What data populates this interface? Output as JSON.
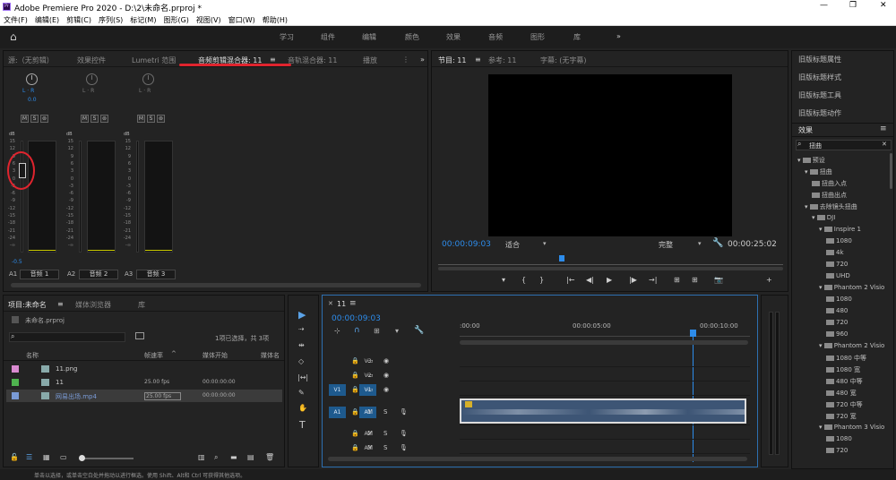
{
  "window": {
    "title": "Adobe Premiere Pro 2020 - D:\\2\\未命名.prproj *"
  },
  "menu": [
    "文件(F)",
    "编辑(E)",
    "剪辑(C)",
    "序列(S)",
    "标记(M)",
    "图形(G)",
    "视图(V)",
    "窗口(W)",
    "帮助(H)"
  ],
  "workspaces": [
    "学习",
    "组件",
    "编辑",
    "颜色",
    "效果",
    "音频",
    "图形",
    "库"
  ],
  "source_panel": {
    "tabs": [
      "源:（无剪辑）",
      "效果控件",
      "Lumetri 范围",
      "音频剪辑混合器: 11",
      "音轨混合器: 11",
      "播放"
    ],
    "channels": [
      {
        "lr": "L  ·  R",
        "val": "0.0",
        "name": "音频 1",
        "code": "A1"
      },
      {
        "lr": "L  ·  R",
        "val": "",
        "name": "音频 2",
        "code": "A2"
      },
      {
        "lr": "L  ·  R",
        "val": "",
        "name": "音频 3",
        "code": "A3"
      }
    ],
    "msb": [
      "M",
      "S",
      "⊚"
    ],
    "db_label": "dB",
    "scale": [
      "15",
      "12",
      "9",
      "6",
      "3",
      "0",
      "-3",
      "-6",
      "-9",
      "-12",
      "-15",
      "-18",
      "-21",
      "-24",
      "-∞"
    ],
    "fader_value": "-0.5"
  },
  "program": {
    "tabs": [
      "节目: 11",
      "参考: 11",
      "字幕: (无字幕)"
    ],
    "timecode": "00:00:09:03",
    "fit": "适合",
    "quality": "完整",
    "duration": "00:00:25:02",
    "controls": [
      "▾",
      "{",
      "}",
      "|←",
      "◀|",
      "▶",
      "|▶",
      "→|",
      "⊞",
      "⊞",
      "📷",
      "+"
    ]
  },
  "right_panels": {
    "items": [
      "旧版标题属性",
      "旧版标题样式",
      "旧版标题工具",
      "旧版标题动作"
    ],
    "effects_title": "效果",
    "search_value": "扭曲",
    "tree": [
      {
        "label": "预设",
        "indent": 0
      },
      {
        "label": "扭曲",
        "indent": 1
      },
      {
        "label": "扭曲入点",
        "indent": 2
      },
      {
        "label": "扭曲出点",
        "indent": 2
      },
      {
        "label": "去除镜头扭曲",
        "indent": 1
      },
      {
        "label": "DJI",
        "indent": 2
      },
      {
        "label": "Inspire 1",
        "indent": 3
      },
      {
        "label": "1080",
        "indent": 4
      },
      {
        "label": "4k",
        "indent": 4
      },
      {
        "label": "720",
        "indent": 4
      },
      {
        "label": "UHD",
        "indent": 4
      },
      {
        "label": "Phantom 2 Visio",
        "indent": 3
      },
      {
        "label": "1080",
        "indent": 4
      },
      {
        "label": "480",
        "indent": 4
      },
      {
        "label": "720",
        "indent": 4
      },
      {
        "label": "960",
        "indent": 4
      },
      {
        "label": "Phantom 2 Visio",
        "indent": 3
      },
      {
        "label": "1080 中等",
        "indent": 4
      },
      {
        "label": "1080 宽",
        "indent": 4
      },
      {
        "label": "480 中等",
        "indent": 4
      },
      {
        "label": "480 宽",
        "indent": 4
      },
      {
        "label": "720 中等",
        "indent": 4
      },
      {
        "label": "720 宽",
        "indent": 4
      },
      {
        "label": "Phantom 3 Visio",
        "indent": 3
      },
      {
        "label": "1080",
        "indent": 4
      },
      {
        "label": "720",
        "indent": 4
      }
    ]
  },
  "project": {
    "tabs": [
      "项目:未命名",
      "媒体浏览器",
      "库"
    ],
    "filename": "未命名.prproj",
    "selection": "1项已选择，共 3项",
    "columns": [
      "名称",
      "帧速率",
      "媒体开始",
      "媒体名"
    ],
    "rows": [
      {
        "name": "11.png",
        "fps": "",
        "start": "",
        "color": "#d98ad0"
      },
      {
        "name": "11",
        "fps": "25.00 fps",
        "start": "00:00:00:00",
        "color": "#4fb34f"
      },
      {
        "name": "网易出场.mp4",
        "fps": "25.00 fps",
        "start": "00:00:00:00",
        "color": "#7a9bd6"
      }
    ]
  },
  "timeline": {
    "tab": "11",
    "timecode": "00:00:09:03",
    "ruler": [
      ":00:00",
      "00:00:05:00",
      "00:00:10:00"
    ],
    "tracks": [
      {
        "code": "V3",
        "left": ""
      },
      {
        "code": "V2",
        "left": ""
      },
      {
        "code": "V1",
        "left": "V1"
      },
      {
        "code": "A1",
        "left": "A1"
      },
      {
        "code": "A2",
        "left": ""
      },
      {
        "code": "A3",
        "left": ""
      }
    ]
  },
  "status_text": "单击以选择，或单击空白处并拖动以进行框选。使用 Shift、Alt和 Ctrl 可获得其他选项。",
  "colors": {
    "accent": "#2d8ceb",
    "highlight_circle": "#e0242e",
    "track_blue": "#1e5a8e"
  }
}
